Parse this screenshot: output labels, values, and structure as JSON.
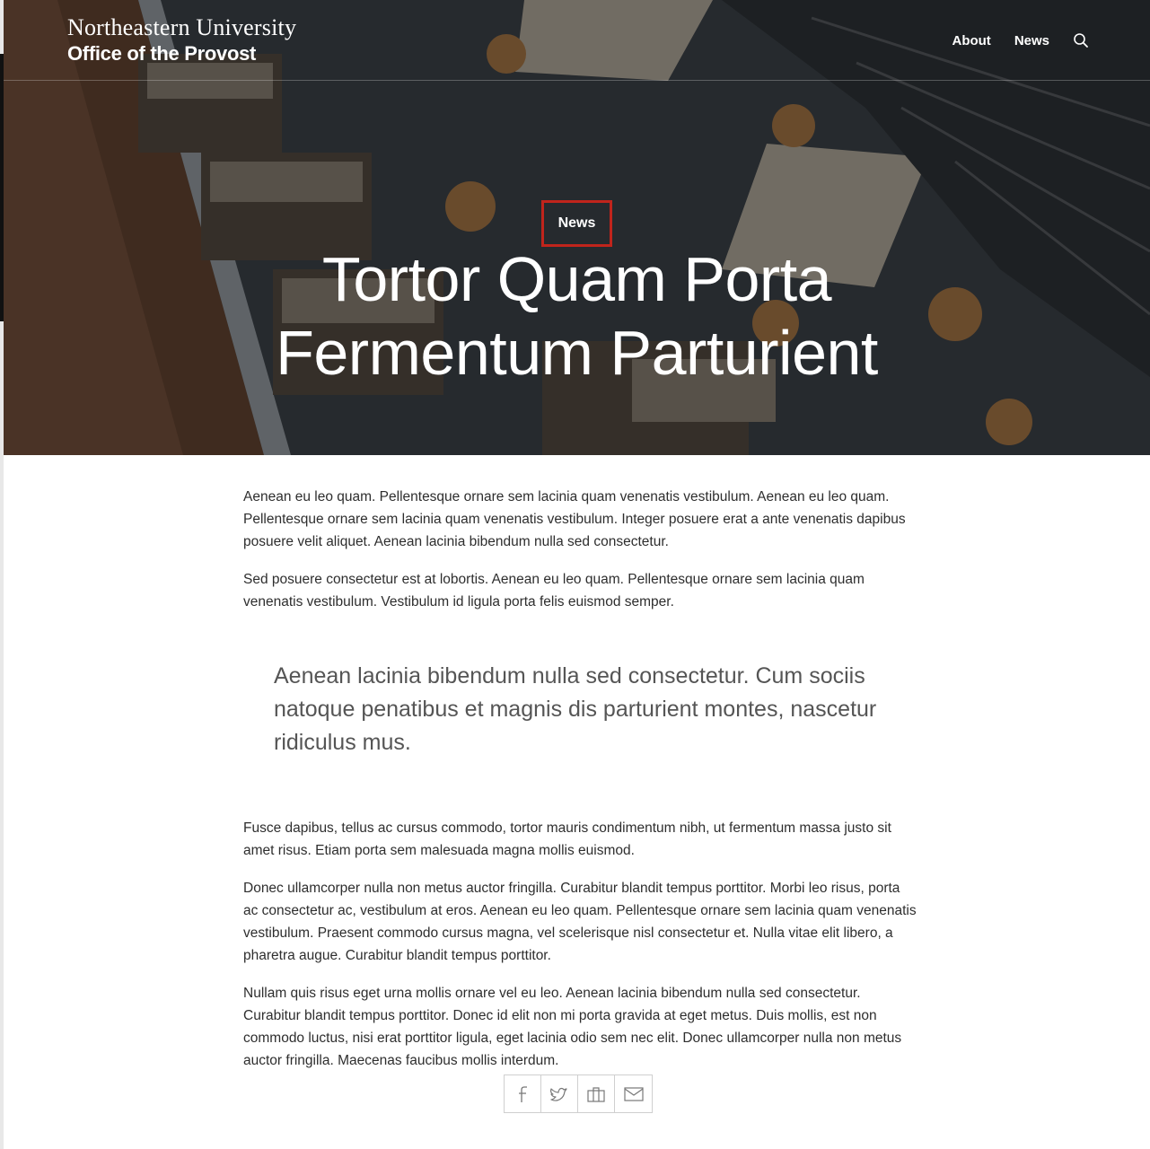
{
  "header": {
    "logo_line1": "Northeastern University",
    "logo_line2": "Office of the Provost",
    "nav": [
      {
        "label": "About"
      },
      {
        "label": "News"
      }
    ],
    "search_icon": "search-icon"
  },
  "hero": {
    "tag": "News",
    "title_line1": "Tortor Quam Porta",
    "title_line2": "Fermentum Parturient",
    "tag_border_color": "#c0241c"
  },
  "article": {
    "paragraphs_before": [
      "Aenean eu leo quam. Pellentesque ornare sem lacinia quam venenatis vestibulum. Aenean eu leo quam. Pellentesque ornare sem lacinia quam venenatis vestibulum. Integer posuere erat a ante venenatis dapibus posuere velit aliquet. Aenean lacinia bibendum nulla sed consectetur.",
      "Sed posuere consectetur est at lobortis. Aenean eu leo quam. Pellentesque ornare sem lacinia quam venenatis vestibulum. Vestibulum id ligula porta felis euismod semper."
    ],
    "quote": "Aenean lacinia bibendum nulla sed consectetur. Cum sociis natoque penatibus et magnis dis parturient montes, nascetur ridiculus mus.",
    "paragraphs_after": [
      "Fusce dapibus, tellus ac cursus commodo, tortor mauris condimentum nibh, ut fermentum massa justo sit amet risus. Etiam porta sem malesuada magna mollis euismod.",
      "Donec ullamcorper nulla non metus auctor fringilla. Curabitur blandit tempus porttitor. Morbi leo risus, porta ac consectetur ac, vestibulum at eros. Aenean eu leo quam. Pellentesque ornare sem lacinia quam venenatis vestibulum. Praesent commodo cursus magna, vel scelerisque nisl consectetur et. Nulla vitae elit libero, a pharetra augue. Curabitur blandit tempus porttitor.",
      "Nullam quis risus eget urna mollis ornare vel eu leo. Aenean lacinia bibendum nulla sed consectetur. Curabitur blandit tempus porttitor. Donec id elit non mi porta gravida at eget metus. Duis mollis, est non commodo luctus, nisi erat porttitor ligula, eget lacinia odio sem nec elit. Donec ullamcorper nulla non metus auctor fringilla. Maecenas faucibus mollis interdum."
    ]
  },
  "share": [
    {
      "icon": "facebook-icon"
    },
    {
      "icon": "twitter-icon"
    },
    {
      "icon": "linkedin-icon"
    },
    {
      "icon": "email-icon"
    }
  ]
}
